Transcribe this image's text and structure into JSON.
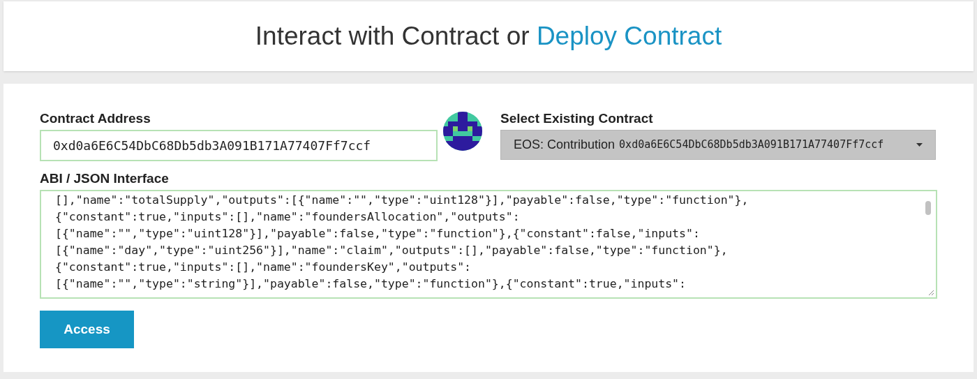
{
  "header": {
    "title": "Interact with Contract",
    "connector": "or",
    "link": "Deploy Contract"
  },
  "contract_address": {
    "label": "Contract Address",
    "value": "0xd0a6E6C54DbC68Db5db3A091B171A77407Ff7ccf"
  },
  "existing_contract": {
    "label": "Select Existing Contract",
    "name": "EOS: Contribution",
    "address": "0xd0a6E6C54DbC68Db5db3A091B171A77407Ff7ccf"
  },
  "abi": {
    "label": "ABI / JSON Interface",
    "lines": [
      "[],\"name\":\"totalSupply\",\"outputs\":[{\"name\":\"\",\"type\":\"uint128\"}],\"payable\":false,\"type\":\"function\"},",
      "{\"constant\":true,\"inputs\":[],\"name\":\"foundersAllocation\",\"outputs\":",
      "[{\"name\":\"\",\"type\":\"uint128\"}],\"payable\":false,\"type\":\"function\"},{\"constant\":false,\"inputs\":",
      "[{\"name\":\"day\",\"type\":\"uint256\"}],\"name\":\"claim\",\"outputs\":[],\"payable\":false,\"type\":\"function\"},",
      "{\"constant\":true,\"inputs\":[],\"name\":\"foundersKey\",\"outputs\":",
      "[{\"name\":\"\",\"type\":\"string\"}],\"payable\":false,\"type\":\"function\"},{\"constant\":true,\"inputs\":"
    ]
  },
  "button": {
    "label": "Access"
  }
}
